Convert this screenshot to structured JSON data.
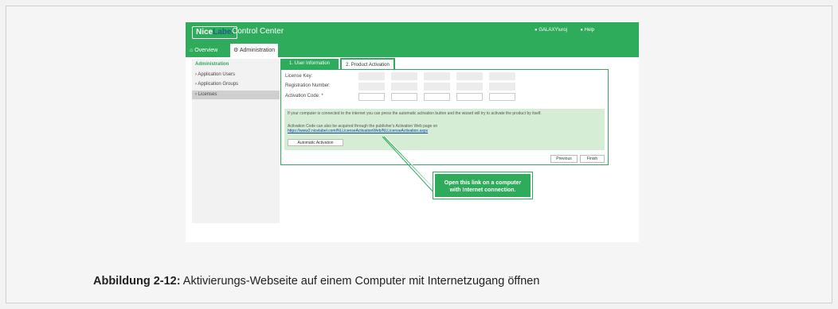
{
  "app": {
    "logo_part1": "Nice",
    "logo_part2": "Label",
    "title": "Control Center",
    "user": "GALAXY\\uroj",
    "help": "Help"
  },
  "tabs": {
    "overview": "Overview",
    "administration": "Administration"
  },
  "sidebar": {
    "title": "Administration",
    "items": [
      {
        "label": "Application Users"
      },
      {
        "label": "Application Groups"
      },
      {
        "label": "Licenses"
      }
    ]
  },
  "wizard": {
    "tab1": "1. User Information",
    "tab2": "2. Product Activation",
    "license_key_label": "License Key:",
    "registration_label": "Registration Number:",
    "activation_label": "Activation Code: *",
    "info_text": "If your computer is connected to the internet you can press the automatic activation button and the wizard will try to activate the product by itself.",
    "info_text2": "Activation Code can also be acquired through the publisher's Activation Web page on",
    "activation_url": "https://www2.nicelabel.com/NLLicenseActivationWeb/NLLicenseActivation.aspx",
    "auto_button": "Automatic Activation",
    "previous_button": "Previous",
    "finish_button": "Finish"
  },
  "callout": {
    "line1": "Open this link on a computer",
    "line2": "with Internet connection."
  },
  "caption": {
    "label": "Abbildung 2-12:",
    "text": " Aktivierungs-Webseite auf einem Computer mit Internetzugang öffnen"
  },
  "colors": {
    "accent": "#2eab5b",
    "link": "#0645ad",
    "info_bg": "#d5ecd5"
  }
}
